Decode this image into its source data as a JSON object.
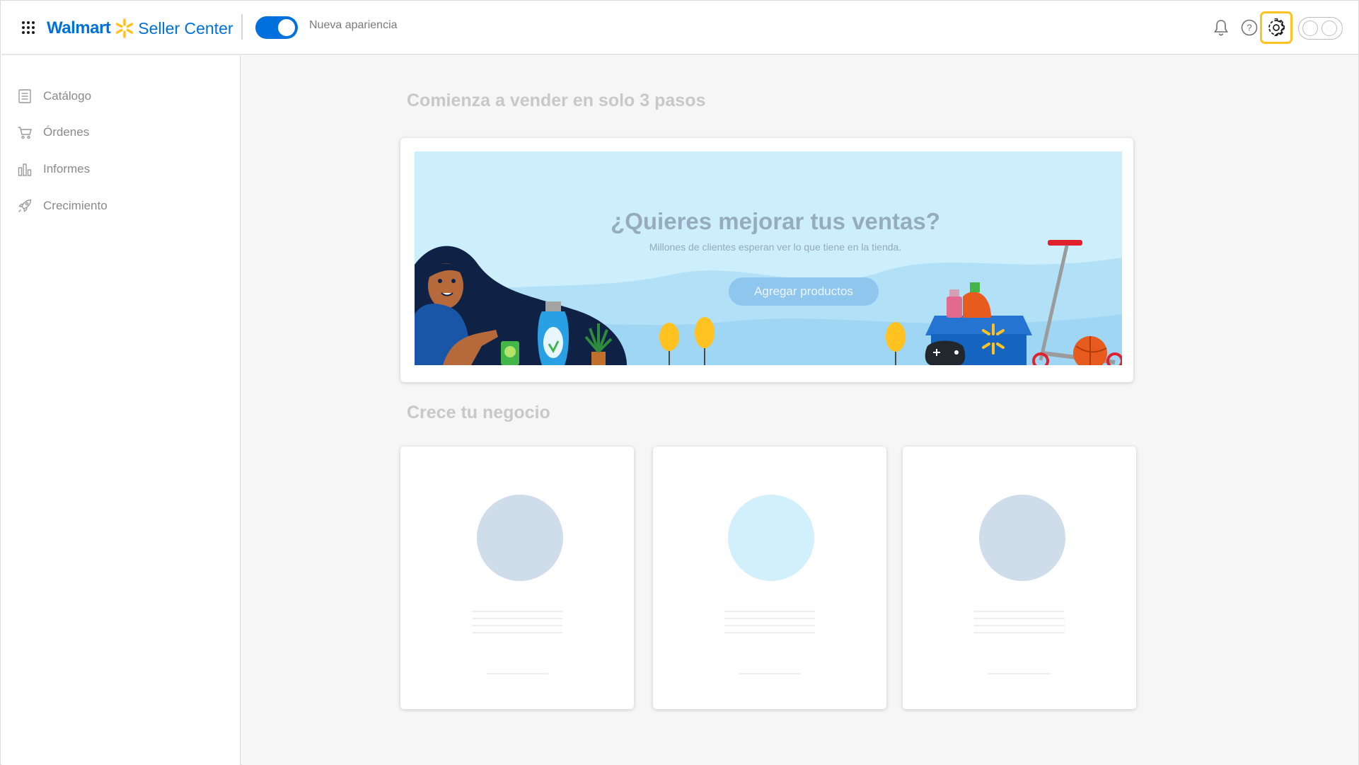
{
  "header": {
    "logo_brand": "Walmart",
    "logo_product": "Seller Center",
    "toggle_label": "Nueva apariencia",
    "toggle_on": true,
    "icons": [
      "apps-grid-icon",
      "bell-icon",
      "help-icon",
      "gear-icon",
      "avatar-toggle-icon"
    ]
  },
  "sidebar": {
    "items": [
      {
        "label": "Catálogo",
        "icon": "catalog-icon"
      },
      {
        "label": "Órdenes",
        "icon": "cart-icon"
      },
      {
        "label": "Informes",
        "icon": "bar-chart-icon"
      },
      {
        "label": "Crecimiento",
        "icon": "rocket-icon"
      }
    ]
  },
  "main": {
    "section1_title": "Comienza a vender en solo 3 pasos",
    "banner": {
      "title": "¿Quieres mejorar tus ventas?",
      "subtitle": "Millones de clientes esperan ver lo que  tiene en la tienda.",
      "button": "Agregar productos"
    },
    "section2_title": "Crece tu negocio"
  },
  "colors": {
    "brand_blue": "#0071dc",
    "spark_yellow": "#ffc220",
    "banner_bg": "#cdeffb",
    "button_bg": "#8fc6ee"
  }
}
